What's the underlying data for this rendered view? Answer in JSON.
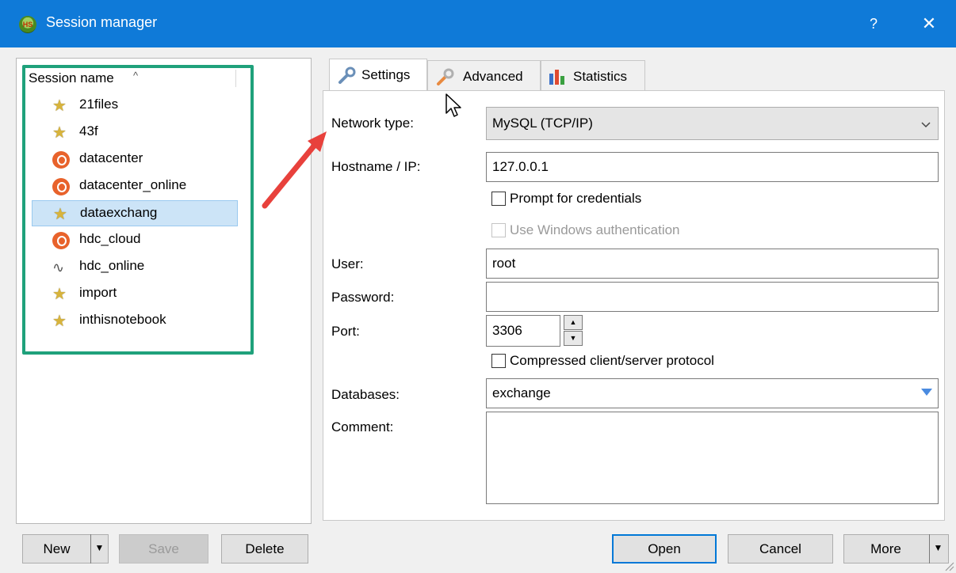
{
  "window": {
    "title": "Session manager",
    "app_icon_text": "HS",
    "help_glyph": "?",
    "close_glyph": "✕"
  },
  "sessions": {
    "column_header": "Session name",
    "sort_glyph": "^",
    "items": [
      {
        "label": "21files",
        "icon": "star-icon"
      },
      {
        "label": "43f",
        "icon": "star-icon"
      },
      {
        "label": "datacenter",
        "icon": "postgres-icon"
      },
      {
        "label": "datacenter_online",
        "icon": "postgres-icon"
      },
      {
        "label": "dataexchang",
        "icon": "star-icon",
        "selected": true
      },
      {
        "label": "hdc_cloud",
        "icon": "postgres-icon"
      },
      {
        "label": "hdc_online",
        "icon": "mysql-dolphin-icon"
      },
      {
        "label": "import",
        "icon": "star-icon"
      },
      {
        "label": "inthisnotebook",
        "icon": "star-icon"
      }
    ]
  },
  "tabs": [
    {
      "label": "Settings",
      "icon": "wrench-icon",
      "active": true
    },
    {
      "label": "Advanced",
      "icon": "wrench-orange-icon",
      "active": false
    },
    {
      "label": "Statistics",
      "icon": "bar-chart-icon",
      "active": false
    }
  ],
  "settings": {
    "network_type_label": "Network type:",
    "network_type_value": "MySQL (TCP/IP)",
    "hostname_label": "Hostname / IP:",
    "hostname_value": "127.0.0.1",
    "prompt_credentials_label": "Prompt for credentials",
    "prompt_credentials_checked": false,
    "windows_auth_label": "Use Windows authentication",
    "windows_auth_checked": false,
    "user_label": "User:",
    "user_value": "root",
    "password_label": "Password:",
    "password_value": "",
    "port_label": "Port:",
    "port_value": "3306",
    "compressed_label": "Compressed client/server protocol",
    "compressed_checked": false,
    "databases_label": "Databases:",
    "databases_value": "exchange",
    "comment_label": "Comment:",
    "comment_value": ""
  },
  "buttons": {
    "new": "New",
    "save": "Save",
    "delete": "Delete",
    "open": "Open",
    "cancel": "Cancel",
    "more": "More"
  },
  "colors": {
    "titlebar": "#0f7ad8",
    "highlight_box": "#1fa17b",
    "annotation_arrow": "#e8413c",
    "selection": "#cce4f7"
  }
}
